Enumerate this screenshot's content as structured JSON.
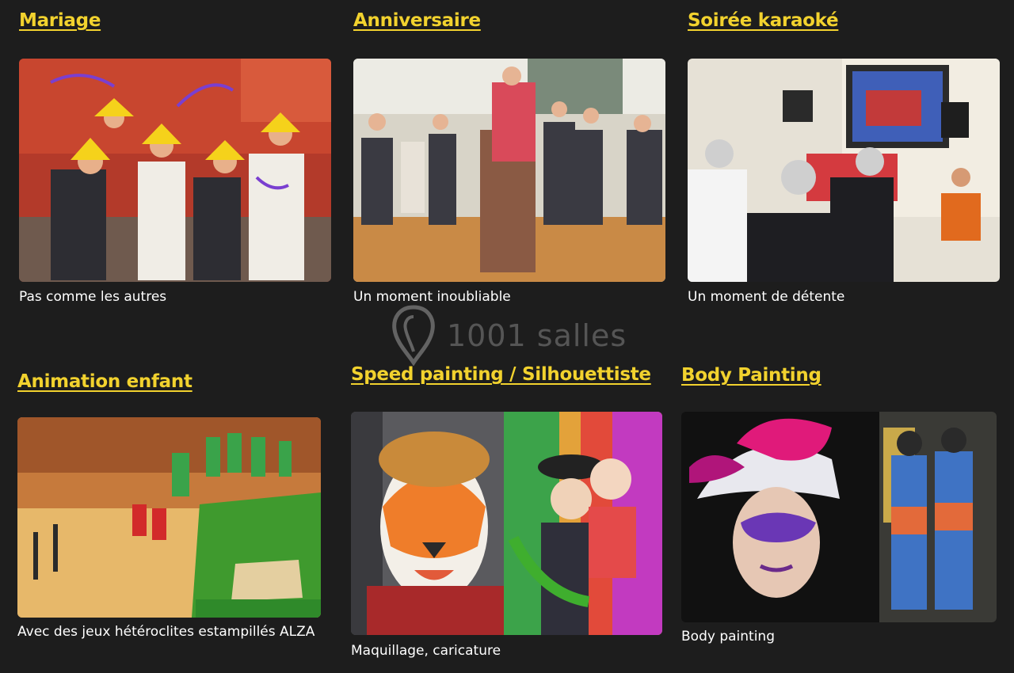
{
  "cards": [
    {
      "title": "Mariage",
      "caption": "Pas comme les autres",
      "photo": "wedding-dance-photo"
    },
    {
      "title": "Anniversaire",
      "caption": "Un moment inoubliable",
      "photo": "birthday-party-photo"
    },
    {
      "title": "Soirée karaoké",
      "caption": "Un moment de détente",
      "photo": "karaoke-night-photo"
    },
    {
      "title": "Animation enfant",
      "caption": "Avec des jeux hétéroclites estampillés ALZA",
      "photo": "kids-games-photo"
    },
    {
      "title": "Speed painting / Silhouettiste",
      "caption": "Maquillage, caricature",
      "photo": "face-painting-photo"
    },
    {
      "title": "Body Painting",
      "caption": "Body painting",
      "photo": "body-painting-photo"
    }
  ],
  "watermark": {
    "text": "1001 salles"
  }
}
